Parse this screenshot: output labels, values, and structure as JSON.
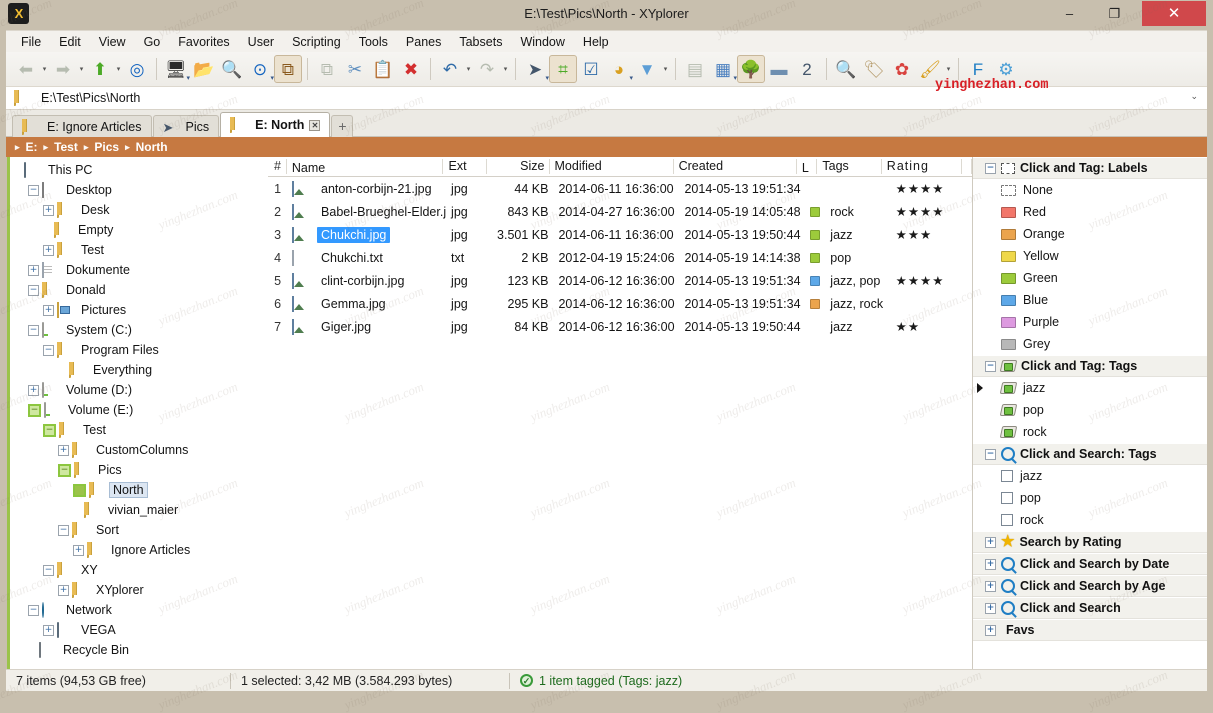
{
  "window": {
    "title": "E:\\Test\\Pics\\North - XYplorer",
    "app_icon": "xyplorer-logo-icon",
    "minimize": "–",
    "maximize": "❐",
    "close": "✕"
  },
  "menubar": {
    "items": [
      "File",
      "Edit",
      "View",
      "Go",
      "Favorites",
      "User",
      "Scripting",
      "Tools",
      "Panes",
      "Tabsets",
      "Window",
      "Help"
    ]
  },
  "toolbar": {
    "groups": [
      {
        "buttons": [
          {
            "name": "back-button",
            "glyph": "⬅",
            "color": "#a9c48e",
            "dropdown": true,
            "disabled": true
          },
          {
            "name": "forward-button",
            "glyph": "➡",
            "color": "#a9c48e",
            "dropdown": true,
            "disabled": true
          },
          {
            "name": "up-button",
            "glyph": "⬆",
            "color": "#4caa27",
            "dropdown": true,
            "disabled": false
          },
          {
            "name": "go-to-target-button",
            "glyph": "◎",
            "color": "#1565c0",
            "dropdown": false,
            "disabled": false
          }
        ]
      },
      {
        "buttons": [
          {
            "name": "desktop-button",
            "glyph": "🖥",
            "color": "#2b2b2b",
            "dropdown": true,
            "disabled": false
          },
          {
            "name": "new-folder-button",
            "glyph": "📂",
            "color": "#e0b54a",
            "dropdown": false,
            "disabled": false
          },
          {
            "name": "find-files-button",
            "glyph": "🔍",
            "color": "#4a7fbf",
            "dropdown": false,
            "disabled": false
          },
          {
            "name": "go-button",
            "glyph": "⊙",
            "color": "#1565c0",
            "dropdown": true,
            "disabled": false
          },
          {
            "name": "copy-to-clipboard-button",
            "glyph": "⧉",
            "color": "#8a5a1e",
            "dropdown": false,
            "disabled": false,
            "pressed": true
          }
        ]
      },
      {
        "buttons": [
          {
            "name": "copy-button",
            "glyph": "⧉",
            "color": "#8fa9c4",
            "dropdown": false,
            "disabled": true
          },
          {
            "name": "cut-button",
            "glyph": "✂",
            "color": "#5f8fbf",
            "dropdown": false,
            "disabled": false
          },
          {
            "name": "paste-button",
            "glyph": "📋",
            "color": "#c9a864",
            "dropdown": false,
            "disabled": false
          },
          {
            "name": "delete-button",
            "glyph": "✖",
            "color": "#d32f2f",
            "dropdown": false,
            "disabled": false
          }
        ]
      },
      {
        "buttons": [
          {
            "name": "undo-button",
            "glyph": "↶",
            "color": "#2f6ba8",
            "dropdown": true,
            "disabled": false
          },
          {
            "name": "redo-button",
            "glyph": "↷",
            "color": "#9aa8b4",
            "dropdown": true,
            "disabled": true
          }
        ]
      },
      {
        "buttons": [
          {
            "name": "send-button",
            "glyph": "➤",
            "color": "#44566b",
            "dropdown": true,
            "disabled": false
          },
          {
            "name": "branch-view-button",
            "glyph": "⌗",
            "color": "#4caa27",
            "dropdown": false,
            "disabled": false,
            "pressed": true
          },
          {
            "name": "checkbox-select-button",
            "glyph": "☑",
            "color": "#2f6ba8",
            "dropdown": false,
            "disabled": false
          },
          {
            "name": "statistics-button",
            "glyph": "◕",
            "color": "#d9a021",
            "dropdown": true,
            "disabled": false
          },
          {
            "name": "filter-button",
            "glyph": "▼",
            "color": "#5d9ed6",
            "dropdown": true,
            "disabled": false
          }
        ]
      },
      {
        "buttons": [
          {
            "name": "thumbnails-view-button",
            "glyph": "▤",
            "color": "#8fa9c4",
            "dropdown": false,
            "disabled": true
          },
          {
            "name": "details-view-button",
            "glyph": "▦",
            "color": "#4a7fbf",
            "dropdown": true,
            "disabled": false
          },
          {
            "name": "tree-pane-button",
            "glyph": "🌳",
            "color": "#4caa27",
            "dropdown": false,
            "disabled": false,
            "pressed": true
          },
          {
            "name": "split-pane-button",
            "glyph": "▬",
            "color": "#6f8fb0",
            "dropdown": false,
            "disabled": false
          },
          {
            "name": "dual-pane-button",
            "glyph": "2",
            "color": "#44566b",
            "dropdown": false,
            "disabled": false
          }
        ]
      },
      {
        "buttons": [
          {
            "name": "search-button",
            "glyph": "🔍",
            "color": "#1f7ec4",
            "dropdown": false,
            "disabled": false
          },
          {
            "name": "tag-button",
            "glyph": "🏷",
            "color": "#b59a6a",
            "dropdown": false,
            "disabled": false
          },
          {
            "name": "color-filters-button",
            "glyph": "✿",
            "color": "#d9433f",
            "dropdown": false,
            "disabled": false
          },
          {
            "name": "highlight-button",
            "glyph": "🖌",
            "color": "#d9a021",
            "dropdown": true,
            "disabled": false
          }
        ]
      },
      {
        "buttons": [
          {
            "name": "floating-preview-button",
            "glyph": "F",
            "color": "#1f7ec4",
            "dropdown": false,
            "disabled": false
          },
          {
            "name": "configuration-button",
            "glyph": "⚙",
            "color": "#4a9ed6",
            "dropdown": false,
            "disabled": false
          }
        ]
      }
    ]
  },
  "address": {
    "icon": "folder-icon",
    "path": "E:\\Test\\Pics\\North",
    "dropdown_caret": "⌄"
  },
  "tabs": {
    "items": [
      {
        "label": "E: Ignore Articles",
        "icon": "folder-icon",
        "active": false,
        "closable": false
      },
      {
        "label": "Pics",
        "icon": "paper-plane-icon",
        "active": false,
        "closable": false
      },
      {
        "label": "E: North",
        "icon": "folder-icon",
        "active": true,
        "closable": true
      }
    ],
    "close_glyph": "✕",
    "add_label": "+"
  },
  "breadcrumb": {
    "separator": "▸",
    "items": [
      "E:",
      "Test",
      "Pics",
      "North"
    ]
  },
  "tree": {
    "nodes": [
      {
        "label": "This PC",
        "depth": 0,
        "expander": "none",
        "icon": "this-pc-icon",
        "selected": false
      },
      {
        "label": "Desktop",
        "depth": 1,
        "expander": "minus",
        "icon": "monitor-icon",
        "selected": false
      },
      {
        "label": "Desk",
        "depth": 2,
        "expander": "plus",
        "icon": "folder-icon",
        "selected": false
      },
      {
        "label": "Empty",
        "depth": 2,
        "expander": "none",
        "icon": "folder-icon",
        "selected": false
      },
      {
        "label": "Test",
        "depth": 2,
        "expander": "plus",
        "icon": "folder-icon",
        "selected": false
      },
      {
        "label": "Dokumente",
        "depth": 1,
        "expander": "plus",
        "icon": "documents-icon",
        "selected": false
      },
      {
        "label": "Donald",
        "depth": 1,
        "expander": "minus",
        "icon": "user-folder-icon",
        "selected": false
      },
      {
        "label": "Pictures",
        "depth": 2,
        "expander": "plus",
        "icon": "pictures-icon",
        "selected": false
      },
      {
        "label": "System (C:)",
        "depth": 1,
        "expander": "minus",
        "icon": "system-drive-icon",
        "selected": false
      },
      {
        "label": "Program Files",
        "depth": 2,
        "expander": "minus",
        "icon": "folder-icon",
        "selected": false
      },
      {
        "label": "Everything",
        "depth": 3,
        "expander": "none",
        "icon": "folder-icon",
        "selected": false
      },
      {
        "label": "Volume (D:)",
        "depth": 1,
        "expander": "plus",
        "icon": "drive-icon",
        "selected": false
      },
      {
        "label": "Volume (E:)",
        "depth": 1,
        "expander": "minus-green",
        "icon": "drive-icon",
        "selected": false
      },
      {
        "label": "Test",
        "depth": 2,
        "expander": "minus-green",
        "icon": "folder-icon",
        "selected": false
      },
      {
        "label": "CustomColumns",
        "depth": 3,
        "expander": "plus",
        "icon": "folder-icon",
        "selected": false
      },
      {
        "label": "Pics",
        "depth": 3,
        "expander": "minus-green",
        "icon": "folder-icon",
        "selected": false
      },
      {
        "label": "North",
        "depth": 4,
        "expander": "green-box",
        "icon": "folder-icon",
        "selected": true
      },
      {
        "label": "vivian_maier",
        "depth": 4,
        "expander": "none",
        "icon": "folder-icon",
        "selected": false
      },
      {
        "label": "Sort",
        "depth": 3,
        "expander": "minus",
        "icon": "folder-icon",
        "selected": false
      },
      {
        "label": "Ignore Articles",
        "depth": 4,
        "expander": "plus",
        "icon": "folder-icon",
        "selected": false
      },
      {
        "label": "XY",
        "depth": 2,
        "expander": "minus",
        "icon": "folder-icon",
        "selected": false
      },
      {
        "label": "XYplorer",
        "depth": 3,
        "expander": "plus",
        "icon": "folder-icon",
        "selected": false
      },
      {
        "label": "Network",
        "depth": 1,
        "expander": "minus",
        "icon": "network-icon",
        "selected": false
      },
      {
        "label": "VEGA",
        "depth": 2,
        "expander": "plus",
        "icon": "computer-icon",
        "selected": false
      },
      {
        "label": "Recycle Bin",
        "depth": 1,
        "expander": "none",
        "icon": "recycle-bin-icon",
        "selected": false
      }
    ]
  },
  "filelist": {
    "columns": [
      "#",
      "Name",
      "Ext",
      "Size",
      "Modified",
      "Created",
      "L",
      "Tags",
      "Rating"
    ],
    "rows": [
      {
        "num": "1",
        "name": "anton-corbijn-21.jpg",
        "icon": "image-file-icon",
        "ext": "jpg",
        "size": "44 KB",
        "modified": "2014-06-11 16:36:00",
        "created": "2014-05-13 19:51:34",
        "label_color": "",
        "tags": "",
        "rating": "★★★★",
        "selected": false
      },
      {
        "num": "2",
        "name": "Babel-Brueghel-Elder.jpg",
        "icon": "image-file-icon",
        "ext": "jpg",
        "size": "843 KB",
        "modified": "2014-04-27 16:36:00",
        "created": "2014-05-19 14:05:48",
        "label_color": "#9ccb3b",
        "tags": "rock",
        "rating": "★★★★",
        "selected": false
      },
      {
        "num": "3",
        "name": "Chukchi.jpg",
        "icon": "image-file-icon",
        "ext": "jpg",
        "size": "3.501 KB",
        "modified": "2014-06-11 16:36:00",
        "created": "2014-05-13 19:50:44",
        "label_color": "#9ccb3b",
        "tags": "jazz",
        "rating": "★★★",
        "selected": true
      },
      {
        "num": "4",
        "name": "Chukchi.txt",
        "icon": "text-file-icon",
        "ext": "txt",
        "size": "2 KB",
        "modified": "2012-04-19 15:24:06",
        "created": "2014-05-19 14:14:38",
        "label_color": "#9ccb3b",
        "tags": "pop",
        "rating": "",
        "selected": false
      },
      {
        "num": "5",
        "name": "clint-corbijn.jpg",
        "icon": "image-file-icon",
        "ext": "jpg",
        "size": "123 KB",
        "modified": "2014-06-12 16:36:00",
        "created": "2014-05-13 19:51:34",
        "label_color": "#5da8e8",
        "tags": "jazz, pop",
        "rating": "★★★★",
        "selected": false
      },
      {
        "num": "6",
        "name": "Gemma.jpg",
        "icon": "image-file-icon",
        "ext": "jpg",
        "size": "295 KB",
        "modified": "2014-06-12 16:36:00",
        "created": "2014-05-13 19:51:34",
        "label_color": "#eba44d",
        "tags": "jazz, rock",
        "rating": "",
        "selected": false
      },
      {
        "num": "7",
        "name": "Giger.jpg",
        "icon": "image-file-icon",
        "ext": "jpg",
        "size": "84 KB",
        "modified": "2014-06-12 16:36:00",
        "created": "2014-05-13 19:50:44",
        "label_color": "",
        "tags": "jazz",
        "rating": "★★",
        "selected": false
      }
    ]
  },
  "catalog": {
    "sections": [
      {
        "title": "Click and Tag: Labels",
        "expander": "minus",
        "head_icon": "dashed-label-icon",
        "items": [
          {
            "label": "None",
            "kind": "swatch-none",
            "color": ""
          },
          {
            "label": "Red",
            "kind": "swatch",
            "color": "#f2766a"
          },
          {
            "label": "Orange",
            "kind": "swatch",
            "color": "#eba44d"
          },
          {
            "label": "Yellow",
            "kind": "swatch",
            "color": "#efd84a"
          },
          {
            "label": "Green",
            "kind": "swatch",
            "color": "#9ccb3b"
          },
          {
            "label": "Blue",
            "kind": "swatch",
            "color": "#5da8e8"
          },
          {
            "label": "Purple",
            "kind": "swatch",
            "color": "#dd9ae0"
          },
          {
            "label": "Grey",
            "kind": "swatch",
            "color": "#b8b8b8"
          }
        ]
      },
      {
        "title": "Click and Tag: Tags",
        "expander": "minus",
        "head_icon": "tag-icon",
        "items": [
          {
            "label": "jazz",
            "kind": "tag",
            "color": "",
            "marker": true
          },
          {
            "label": "pop",
            "kind": "tag",
            "color": ""
          },
          {
            "label": "rock",
            "kind": "tag",
            "color": ""
          }
        ]
      },
      {
        "title": "Click and Search: Tags",
        "expander": "minus",
        "head_icon": "magnifier-icon",
        "items": [
          {
            "label": "jazz",
            "kind": "checkbox",
            "color": ""
          },
          {
            "label": "pop",
            "kind": "checkbox",
            "color": ""
          },
          {
            "label": "rock",
            "kind": "checkbox",
            "color": ""
          }
        ]
      },
      {
        "title": "Search by Rating",
        "expander": "plus",
        "head_icon": "star-icon",
        "items": []
      },
      {
        "title": "Click and Search by Date",
        "expander": "plus",
        "head_icon": "magnifier-icon",
        "items": []
      },
      {
        "title": "Click and Search by Age",
        "expander": "plus",
        "head_icon": "magnifier-icon",
        "items": []
      },
      {
        "title": "Click and Search",
        "expander": "plus",
        "head_icon": "magnifier-icon",
        "items": []
      },
      {
        "title": "Favs",
        "expander": "plus",
        "head_icon": "none",
        "items": []
      }
    ]
  },
  "statusbar": {
    "items_text": "7 items (94,53 GB free)",
    "selection_text": "1 selected: 3,42 MB (3.584.293 bytes)",
    "tagged_text": "1 item tagged (Tags: jazz)",
    "tagged_icon": "green-check-icon"
  },
  "watermark": {
    "tiles": "yinghezhan.com",
    "red_text": "yinghezhan.com"
  },
  "colors": {
    "frame": "#c8bfae",
    "breadcrumb": "#c67941",
    "selection": "#3399ff",
    "tree_accent": "#9bc34a",
    "close_button": "#d0484b"
  }
}
